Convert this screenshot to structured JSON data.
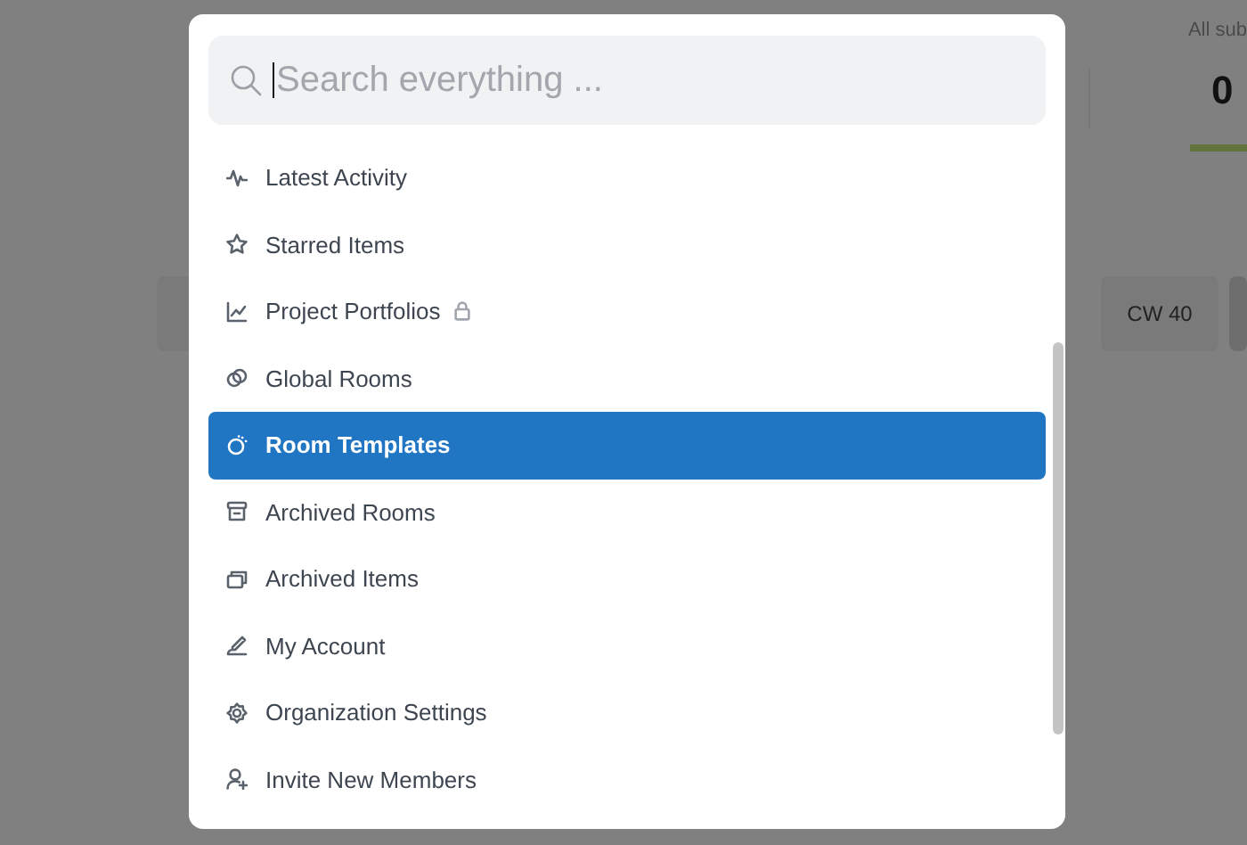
{
  "background": {
    "stat_label": "All sub",
    "stat_value": "0",
    "week_chips": [
      "CW 40"
    ]
  },
  "search": {
    "placeholder": "Search everything ..."
  },
  "menu_items": [
    {
      "label": "Latest Activity",
      "selected": false,
      "locked": false
    },
    {
      "label": "Starred Items",
      "selected": false,
      "locked": false
    },
    {
      "label": "Project Portfolios",
      "selected": false,
      "locked": true
    },
    {
      "label": "Global Rooms",
      "selected": false,
      "locked": false
    },
    {
      "label": "Room Templates",
      "selected": true,
      "locked": false
    },
    {
      "label": "Archived Rooms",
      "selected": false,
      "locked": false
    },
    {
      "label": "Archived Items",
      "selected": false,
      "locked": false
    },
    {
      "label": "My Account",
      "selected": false,
      "locked": false
    },
    {
      "label": "Organization Settings",
      "selected": false,
      "locked": false
    },
    {
      "label": "Invite New Members",
      "selected": false,
      "locked": false
    }
  ]
}
